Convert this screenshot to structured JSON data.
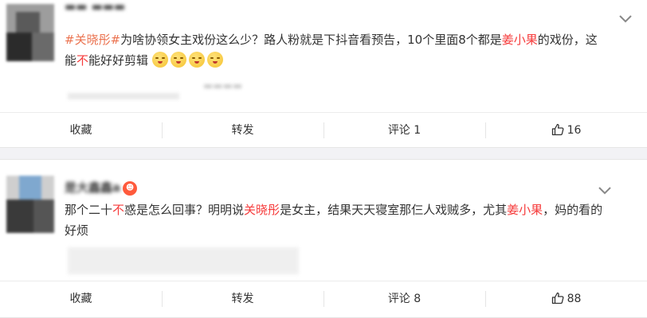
{
  "comments": [
    {
      "hashtag": "#关晓彤#",
      "text_a": "为啥协领女主戏份这么少？路人粉就是下抖音看预告，10个里面8个都是",
      "highlight1": "姜小果",
      "text_b": "的戏份，这能",
      "highlight2": "不",
      "text_c": "能好好剪辑",
      "emoji_name": "shush-face-emoji",
      "actions": {
        "favorite": "收藏",
        "repost": "转发",
        "comment": "评论 1",
        "likes": "16"
      }
    },
    {
      "username": "是大鑫鑫a",
      "text_a": "那个二十",
      "highlight1": "不",
      "text_b": "惑是怎么回事？明明说",
      "highlight2": "关晓彤",
      "text_c": "是女主，结果天天寝室那仨人戏贼多，尤其",
      "highlight3": "姜小果",
      "text_d": "，妈的看的好烦",
      "actions": {
        "favorite": "收藏",
        "repost": "转发",
        "comment": "评论 8",
        "likes": "88"
      }
    }
  ],
  "colors": {
    "hashtag": "#eb7350",
    "highlight": "#f63b3b",
    "card_bg": "#ffffff",
    "page_bg": "#f2f2f5"
  },
  "icons": {
    "collapse": "chevron-down-icon",
    "like": "thumbs-up-icon",
    "badge": "vip-badge-icon"
  }
}
